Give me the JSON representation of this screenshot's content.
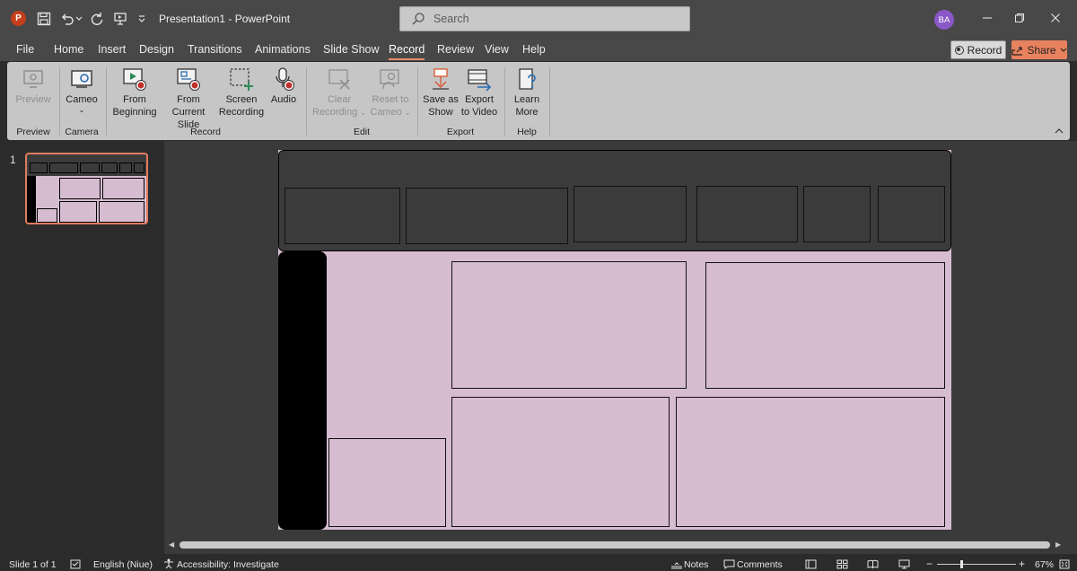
{
  "titlebar": {
    "app_logo": "P",
    "document_title": "Presentation1  -  PowerPoint",
    "search_placeholder": "Search",
    "avatar_initials": "BA"
  },
  "menu": {
    "tabs": [
      "File",
      "Home",
      "Insert",
      "Design",
      "Transitions",
      "Animations",
      "Slide Show",
      "Record",
      "Review",
      "View",
      "Help"
    ],
    "active_tab": "Record",
    "record_label": "Record",
    "share_label": "Share"
  },
  "ribbon": {
    "preview": {
      "label": "Preview",
      "group": "Preview"
    },
    "cameo": {
      "label": "Cameo",
      "group": "Camera"
    },
    "record": {
      "from_beginning": [
        "From",
        "Beginning"
      ],
      "from_current": [
        "From",
        "Current Slide"
      ],
      "screen_recording": [
        "Screen",
        "Recording"
      ],
      "audio": "Audio",
      "group": "Record"
    },
    "edit": {
      "clear_recording": [
        "Clear",
        "Recording"
      ],
      "reset_to_cameo": [
        "Reset to",
        "Cameo"
      ],
      "group": "Edit"
    },
    "export": {
      "save_as_show": [
        "Save as",
        "Show"
      ],
      "export_to_video": [
        "Export",
        "to Video"
      ],
      "group": "Export"
    },
    "help": {
      "learn_more": [
        "Learn",
        "More"
      ],
      "group": "Help"
    }
  },
  "thumbnails": {
    "slide_number": "1"
  },
  "status": {
    "slide_info": "Slide 1 of 1",
    "language": "English (Niue)",
    "accessibility": "Accessibility: Investigate",
    "notes": "Notes",
    "comments": "Comments",
    "zoom_minus": "−",
    "zoom_plus": "+",
    "zoom_level": "67%"
  },
  "colors": {
    "accent": "#e88d6b",
    "slide_background": "#d6bcd0",
    "header_band": "#3b3b3b",
    "share_button": "#e8825e"
  }
}
